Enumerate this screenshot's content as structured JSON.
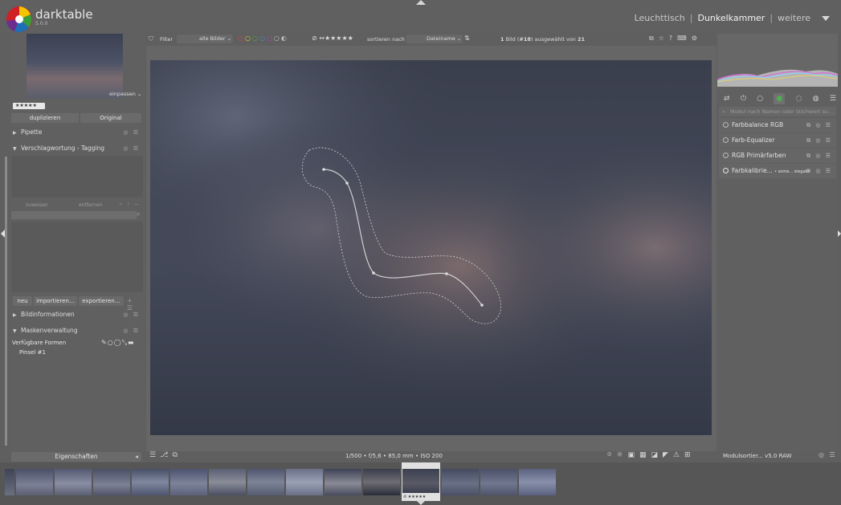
{
  "app": {
    "name": "darktable",
    "version": "5.0.0"
  },
  "views": {
    "items": [
      "Leuchttisch",
      "Dunkelkammer",
      "weitere"
    ],
    "active": "Dunkelkammer"
  },
  "navigation": {
    "zoom_label": "einpassen",
    "stars": "★★★★★"
  },
  "left_panel": {
    "duplicate_label": "duplizieren",
    "original_label": "Original",
    "sections": {
      "pipette": "Pipette",
      "tagging": "Verschlagwortung - Tagging",
      "image_info": "Bildinformationen",
      "mask_manager": "Maskenverwaltung"
    },
    "tag_buttons": {
      "attach": "zuweisen",
      "detach": "entfernen"
    },
    "tag_actions": {
      "new": "neu",
      "import": "importieren…",
      "export": "exportieren…"
    },
    "mask": {
      "available_shapes": "Verfügbare Formen",
      "brush": "Pinsel #1"
    },
    "properties_label": "Eigenschaften"
  },
  "top_toolbar": {
    "filter_label": "Filter",
    "filter_value": "alle Bilder",
    "rating": "★★★★★",
    "sort_label": "sortieren nach",
    "sort_value": "Dateiname",
    "selection_count": "1",
    "selection_index": "#18",
    "selection_total": "21",
    "selection_prefix": "Bild (",
    "selection_middle": ") ausgewählt von"
  },
  "bottom_info": {
    "exif": "1/500 • f/5,6 • 85,0 mm • ISO 200"
  },
  "right_panel": {
    "search_placeholder": "Modul nach Namen oder Stichwort su...",
    "modules": [
      {
        "name": "Farbbalance RGB"
      },
      {
        "name": "Farb-Equalizer"
      },
      {
        "name": "RGB Primärfarben"
      },
      {
        "name": "Farbkalibrie...",
        "note": "• some... stegabr"
      }
    ],
    "module_order": "Modulsortier... v5.0 RAW"
  },
  "filmstrip": {
    "selected_stars": "★★★★★"
  },
  "colors": {
    "background": "#606060",
    "panel": "#606060",
    "accent_green": "#4caf50"
  }
}
